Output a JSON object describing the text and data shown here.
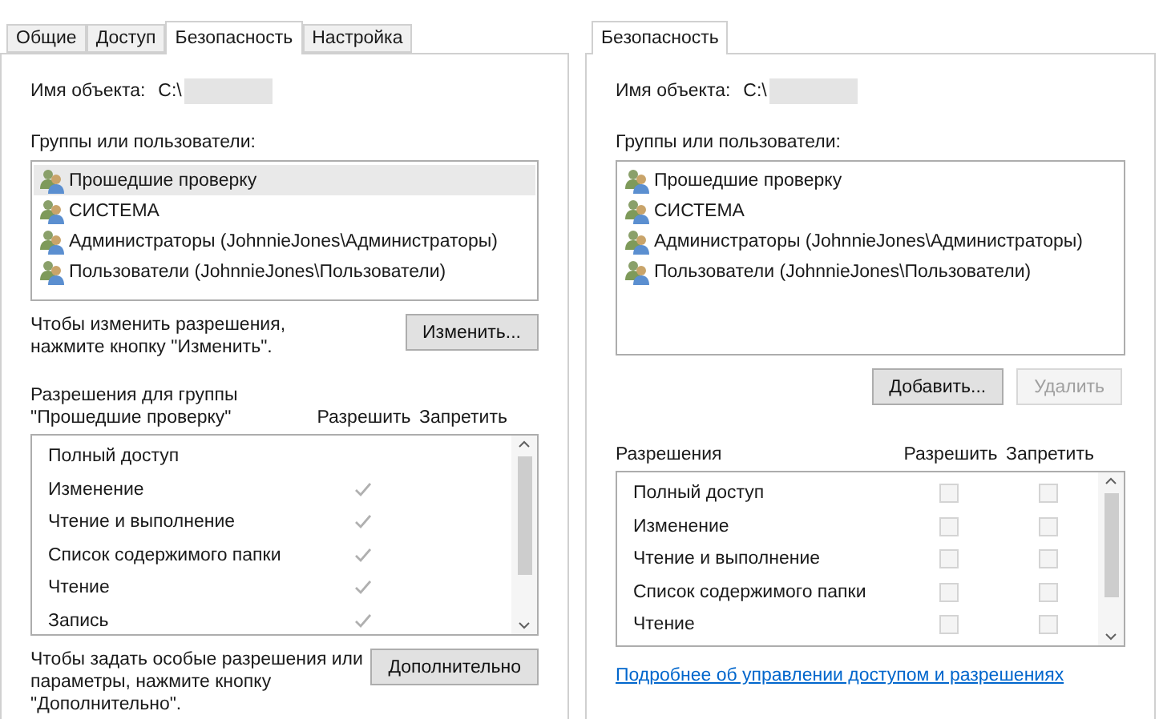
{
  "left_dialog": {
    "tabs": [
      {
        "label": "Общие",
        "selected": false
      },
      {
        "label": "Доступ",
        "selected": false
      },
      {
        "label": "Безопасность",
        "selected": true
      },
      {
        "label": "Настройка",
        "selected": false
      }
    ],
    "object_name": {
      "label": "Имя объекта:",
      "value": "C:\\"
    },
    "groups_label": "Группы или пользователи:",
    "groups": [
      {
        "name": "Прошедшие проверку",
        "selected": true
      },
      {
        "name": "СИСТЕМА",
        "selected": false
      },
      {
        "name": "Администраторы (JohnnieJones\\Администраторы)",
        "selected": false
      },
      {
        "name": "Пользователи (JohnnieJones\\Пользователи)",
        "selected": false
      }
    ],
    "change_hint": "Чтобы изменить разрешения,\nнажмите кнопку \"Изменить\".",
    "change_button": "Изменить...",
    "permissions_label": "Разрешения для группы\n\"Прошедшие проверку\"",
    "columns": [
      "Разрешить",
      "Запретить"
    ],
    "permissions": [
      {
        "kind": "checkmark",
        "name": "Полный доступ",
        "allow": false
      },
      {
        "kind": "checkmark",
        "name": "Изменение",
        "allow": true
      },
      {
        "kind": "checkmark",
        "name": "Чтение и выполнение",
        "allow": true
      },
      {
        "kind": "checkmark",
        "name": "Список содержимого папки",
        "allow": true
      },
      {
        "kind": "checkmark",
        "name": "Чтение",
        "allow": true
      },
      {
        "kind": "checkmark",
        "name": "Запись",
        "allow": true
      }
    ],
    "advanced_hint": "Чтобы задать особые разрешения или\nпараметры, нажмите кнопку\n\"Дополнительно\".",
    "advanced_button": "Дополнительно"
  },
  "right_dialog": {
    "tabs": [
      {
        "label": "Безопасность",
        "selected": true
      }
    ],
    "object_name": {
      "label": "Имя объекта:",
      "value": "C:\\"
    },
    "groups_label": "Группы или пользователи:",
    "groups": [
      {
        "name": "Прошедшие проверку",
        "selected": false
      },
      {
        "name": "СИСТЕМА",
        "selected": false
      },
      {
        "name": "Администраторы (JohnnieJones\\Администраторы)",
        "selected": false
      },
      {
        "name": "Пользователи (JohnnieJones\\Пользователи)",
        "selected": false
      }
    ],
    "buttons": [
      {
        "label": "Добавить...",
        "disabled": false
      },
      {
        "label": "Удалить",
        "disabled": true
      }
    ],
    "permissions_label": "Разрешения",
    "columns": [
      "Разрешить",
      "Запретить"
    ],
    "permissions": [
      {
        "kind": "checkbox",
        "name": "Полный доступ",
        "allow": false,
        "deny": false
      },
      {
        "kind": "checkbox",
        "name": "Изменение",
        "allow": false,
        "deny": false
      },
      {
        "kind": "checkbox",
        "name": "Чтение и выполнение",
        "allow": false,
        "deny": false
      },
      {
        "kind": "checkbox",
        "name": "Список содержимого папки",
        "allow": false,
        "deny": false
      },
      {
        "kind": "checkbox",
        "name": "Чтение",
        "allow": false,
        "deny": false
      }
    ],
    "link": "Подробнее об управлении доступом и разрешениях"
  }
}
